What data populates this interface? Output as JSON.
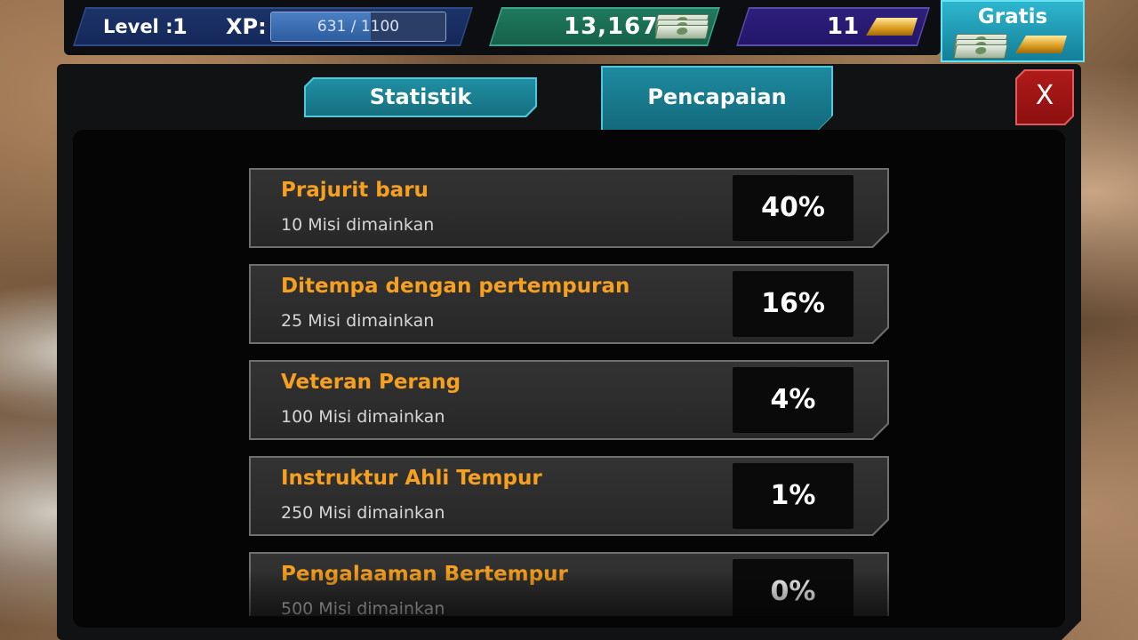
{
  "hud": {
    "level_label": "Level :",
    "level_value": "1",
    "xp_label": "XP:",
    "xp_text": "631 / 1100",
    "xp_progress": 0.5736,
    "money": "13,167",
    "gold": "11",
    "free_label": "Gratis",
    "icons": [
      "cash-stack-icon",
      "gold-bar-icon"
    ]
  },
  "tabs": {
    "stats": "Statistik",
    "achievements": "Pencapaian",
    "active": "achievements"
  },
  "close_label": "X",
  "achievements": [
    {
      "title": "Prajurit baru",
      "desc": "10 Misi dimainkan",
      "percent": "40%"
    },
    {
      "title": "Ditempa dengan pertempuran",
      "desc": "25 Misi dimainkan",
      "percent": "16%"
    },
    {
      "title": "Veteran Perang",
      "desc": "100 Misi dimainkan",
      "percent": "4%"
    },
    {
      "title": "Instruktur Ahli Tempur",
      "desc": "250 Misi dimainkan",
      "percent": "1%"
    },
    {
      "title": "Pengalaaman Bertempur",
      "desc": "500 Misi dimainkan",
      "percent": "0%"
    }
  ],
  "colors": {
    "title_orange": "#f5a020",
    "tab_teal": "#1d8aa0",
    "close_red": "#b01a1a",
    "money_green": "#1f7a5c",
    "gold_purple": "#2d1f7c"
  }
}
